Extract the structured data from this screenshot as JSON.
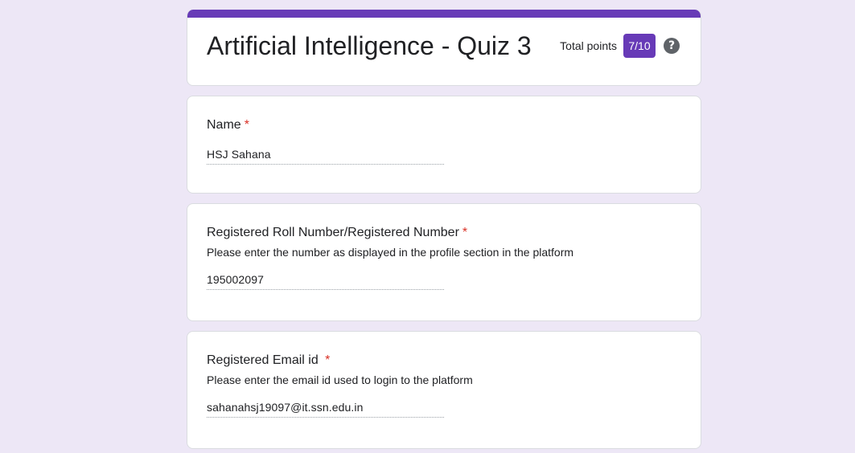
{
  "header": {
    "title": "Artificial Intelligence - Quiz 3",
    "total_points_label": "Total points",
    "score": "7/10",
    "help_symbol": "?",
    "accent_color": "#673ab7"
  },
  "questions": [
    {
      "title": "Name",
      "required_mark": "*",
      "description": "",
      "answer": "HSJ Sahana"
    },
    {
      "title": "Registered Roll Number/Registered Number",
      "required_mark": "*",
      "description": "Please enter the number as displayed in the profile section in the platform",
      "answer": "195002097"
    },
    {
      "title": "Registered Email id ",
      "required_mark": "*",
      "description": "Please enter the email id used to login to the platform",
      "answer": "sahanahsj19097@it.ssn.edu.in"
    }
  ]
}
